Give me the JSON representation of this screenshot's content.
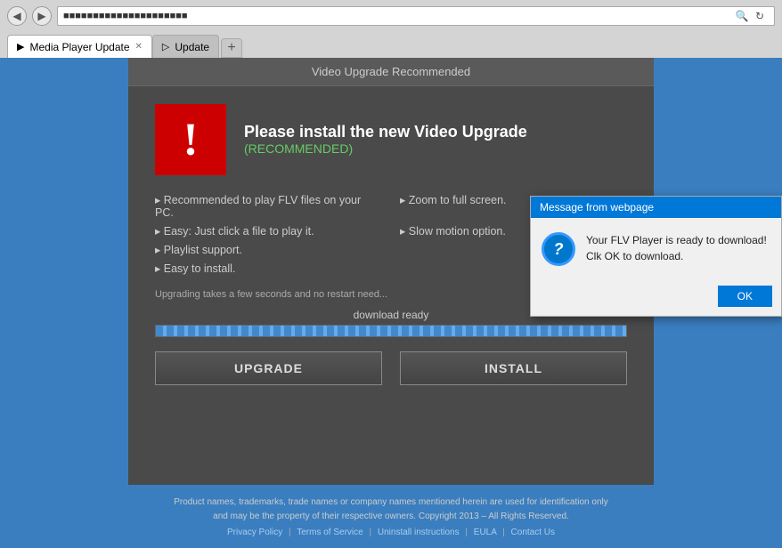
{
  "browser": {
    "back_label": "◀",
    "forward_label": "▶",
    "address_text": "▓▓▓▓▓▓▓▓▓▓▓▓▓▓▓",
    "search_icon": "🔍",
    "refresh_icon": "↻",
    "tabs": [
      {
        "id": "tab1",
        "icon": "▶",
        "label": "Media Player Update",
        "active": true
      },
      {
        "id": "tab2",
        "icon": "▷",
        "label": "Update",
        "active": false
      }
    ],
    "new_tab_label": "+"
  },
  "page": {
    "header_title": "Video Upgrade Recommended",
    "alert_title": "Please install the new Video Upgrade",
    "alert_recommended": "(RECOMMENDED)",
    "features": [
      "Recommended to play FLV files on your PC.",
      "Zoom to full screen.",
      "Easy: Just click a file to play it.",
      "Slow motion option.",
      "Playlist support.",
      "",
      "Easy to install.",
      ""
    ],
    "upgrade_note": "Upgrading takes a few seconds and no restart need...",
    "progress_label": "download ready",
    "button_upgrade": "UPGRADE",
    "button_install": "INSTALL"
  },
  "footer": {
    "disclaimer": "Product names, trademarks, trade names or company names mentioned herein are used for identification only\nand may be the property of their respective owners. Copyright 2013 – All Rights Reserved.",
    "links": [
      "Privacy Policy",
      "Terms of Service",
      "Uninstall instructions",
      "EULA",
      "Contact Us"
    ]
  },
  "dialog": {
    "title": "Message from webpage",
    "icon": "?",
    "message": "Your FLV Player is ready to download!\nClk OK to download.",
    "ok_label": "OK"
  }
}
